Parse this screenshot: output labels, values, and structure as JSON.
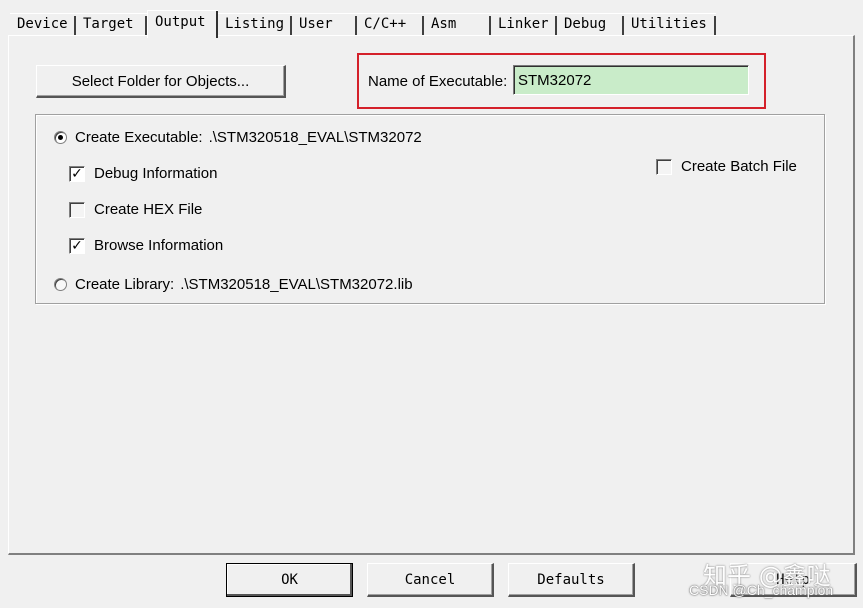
{
  "tabs": [
    {
      "label": "Device"
    },
    {
      "label": "Target"
    },
    {
      "label": "Output",
      "active": true
    },
    {
      "label": "Listing"
    },
    {
      "label": "User"
    },
    {
      "label": "C/C++"
    },
    {
      "label": "Asm"
    },
    {
      "label": "Linker"
    },
    {
      "label": "Debug"
    },
    {
      "label": "Utilities"
    }
  ],
  "output": {
    "select_folder_label": "Select Folder for Objects...",
    "exe_name_label": "Name of Executable:",
    "exe_name_value": "STM32072",
    "create_executable": {
      "label": "Create Executable:",
      "path": ".\\STM320518_EVAL\\STM32072",
      "selected": true
    },
    "debug_info": {
      "label": "Debug Information",
      "checked": true
    },
    "create_hex": {
      "label": "Create HEX File",
      "checked": false
    },
    "browse_info": {
      "label": "Browse Information",
      "checked": true
    },
    "create_library": {
      "label": "Create Library:",
      "path": ".\\STM320518_EVAL\\STM32072.lib",
      "selected": false
    },
    "create_batch": {
      "label": "Create Batch File",
      "checked": false
    }
  },
  "buttons": {
    "ok": "OK",
    "cancel": "Cancel",
    "defaults": "Defaults",
    "help": "Help"
  },
  "watermark": {
    "line1": "知乎 @鑫哒",
    "line2": "CSDN @Ch_champion"
  },
  "colors": {
    "highlight": "#d4202a",
    "exe_input_bg": "#c9ecc9"
  }
}
